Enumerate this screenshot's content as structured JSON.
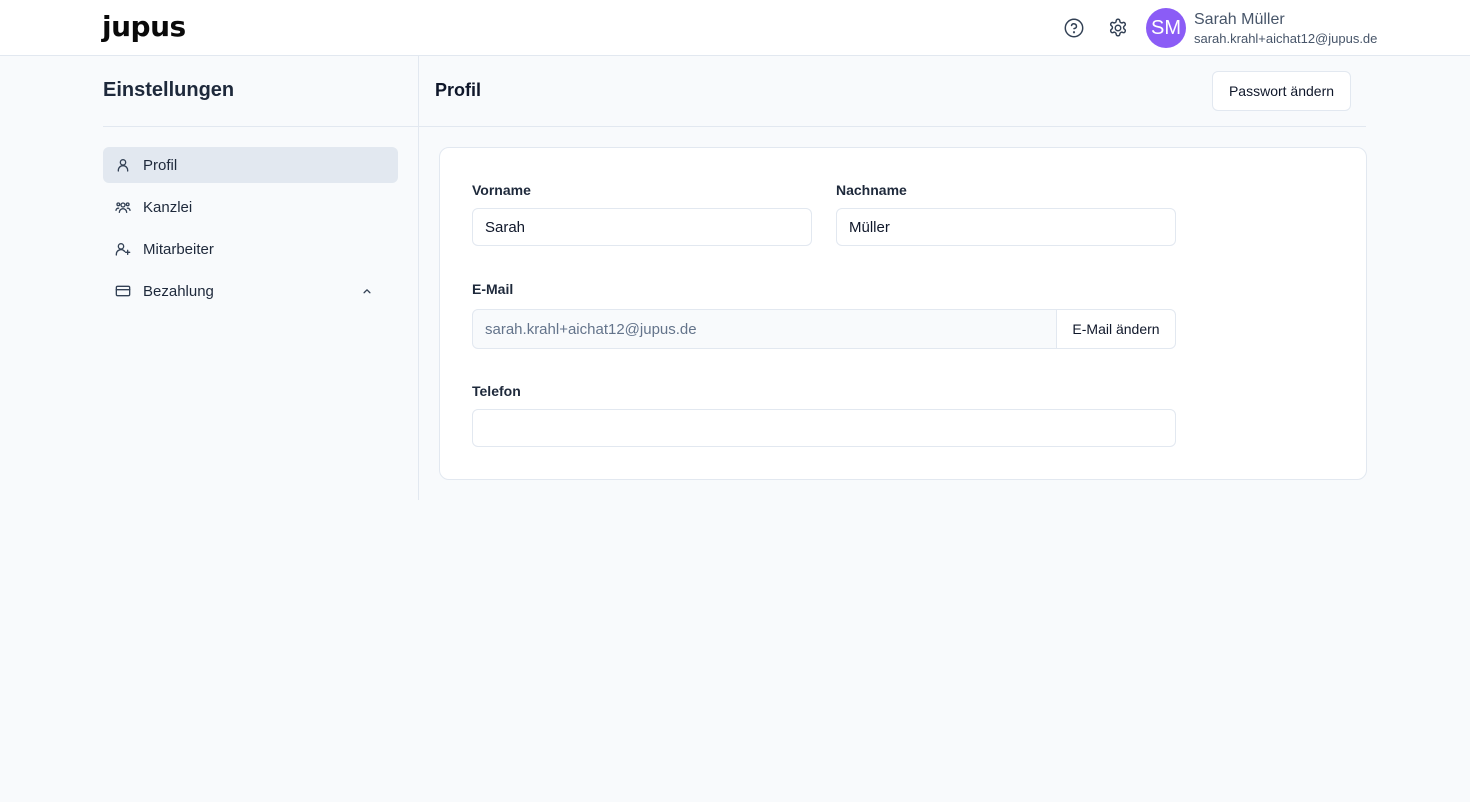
{
  "header": {
    "logo": "jupus",
    "help_icon": "help-circle-icon",
    "settings_icon": "gear-icon",
    "user": {
      "initials": "SM",
      "name": "Sarah Müller",
      "email": "sarah.krahl+aichat12@jupus.de",
      "avatar_color": "#8b5cf6"
    }
  },
  "sidebar": {
    "title": "Einstellungen",
    "items": [
      {
        "label": "Profil",
        "icon": "user-icon",
        "active": true
      },
      {
        "label": "Kanzlei",
        "icon": "users-group-icon",
        "active": false
      },
      {
        "label": "Mitarbeiter",
        "icon": "user-plus-icon",
        "active": false
      },
      {
        "label": "Bezahlung",
        "icon": "credit-card-icon",
        "active": false,
        "expandable": true
      }
    ]
  },
  "main": {
    "title": "Profil",
    "change_password_label": "Passwort ändern",
    "form": {
      "first_name_label": "Vorname",
      "first_name_value": "Sarah",
      "last_name_label": "Nachname",
      "last_name_value": "Müller",
      "email_label": "E-Mail",
      "email_value": "sarah.krahl+aichat12@jupus.de",
      "change_email_label": "E-Mail ändern",
      "phone_label": "Telefon",
      "phone_value": ""
    }
  }
}
